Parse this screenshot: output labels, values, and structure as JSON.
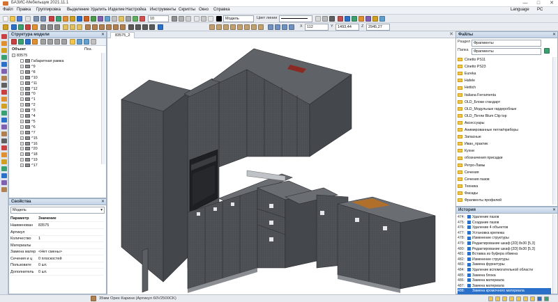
{
  "title": "БАЗИС-Мебельщик 2021.11.1",
  "window_controls": {
    "minimize": "—",
    "maximize": "□",
    "close": "✕"
  },
  "menu": [
    "Файл",
    "Правка",
    "Группировка",
    "Выделение",
    "Удалить",
    "Изделие",
    "Настройка",
    "Инструменты",
    "Скрипты",
    "Окно",
    "Справка"
  ],
  "menu_right": {
    "language": "Language",
    "pc": "PC"
  },
  "toolbar": {
    "layer_combo": "Модель",
    "line_color_label": "Цвет линии",
    "zoom_value": "10",
    "x_label": "X",
    "x_value": "112",
    "y_label": "Y",
    "y_value": "1493,44",
    "z_label": "Z",
    "z_value": "2945,27"
  },
  "model_tree": {
    "title": "Структура модели",
    "close": "✕",
    "col_object": "Объект",
    "col_pos": "Поз.",
    "root": "83575",
    "items": [
      "Габаритная рамка",
      "^9",
      "^8",
      "^10",
      "^11",
      "^12",
      "^0",
      "^1",
      "^2",
      "^3",
      "^4",
      "^5",
      "^6",
      "^7",
      "^15",
      "^16",
      "^20",
      "^18",
      "^19",
      "^17"
    ]
  },
  "properties": {
    "title": "Свойства",
    "close": "✕",
    "selector": "Модель",
    "col_param": "Параметр",
    "col_value": "Значение",
    "rows": [
      {
        "key": "Наименован",
        "value": "83575"
      },
      {
        "key": "Артикул",
        "value": ""
      },
      {
        "key": "Количество",
        "value": "1"
      },
      {
        "key": "Материалы",
        "value": ""
      },
      {
        "key": "Замена матер",
        "value": "<Нет смены>"
      },
      {
        "key": "Сечения и ц",
        "value": "0 плоскостей"
      },
      {
        "key": "Пользовате",
        "value": "0 шт."
      },
      {
        "key": "Дополнитель",
        "value": "0 шт."
      }
    ]
  },
  "viewport": {
    "tab": "83575_2"
  },
  "files": {
    "title": "Файлы",
    "close": "✕",
    "section_label": "Раздел",
    "section_value": "Фрагменты",
    "folder_label": "Папка",
    "folder_value": "Фрагменты",
    "folders": [
      "Cinetto PS11",
      "Cinetto PS23",
      "Eureka",
      "Hafele",
      "Hettich",
      "Italiana Ferramenta",
      "OLD_Блоки стандарт",
      "OLD_Модульные гардеробные",
      "OLD_Петли Blum Clip top",
      "Аксессуары",
      "Анимированные петли/приборы",
      "Запасные",
      "Иван_практик",
      "Кухни",
      "обозначения присадки",
      "Ретро-Ламы",
      "Сечения",
      "Сечения пазов",
      "Техника",
      "Фасады",
      "Фрагменты профилей"
    ]
  },
  "history": {
    "title": "История",
    "close": "✕",
    "rows": [
      {
        "n": "474:",
        "text": "Удаление пазов"
      },
      {
        "n": "475:",
        "text": "Создание пазов"
      },
      {
        "n": "476:",
        "text": "Удаление 4 объектов"
      },
      {
        "n": "477:",
        "text": "Установка крепежа"
      },
      {
        "n": "478:",
        "text": "Изменение структуры"
      },
      {
        "n": "479:",
        "text": "Редактирование шкаф [2D] 8x30 [5,3]"
      },
      {
        "n": "480:",
        "text": "Редактирование шкаф [2D] 8x30 [5,3]"
      },
      {
        "n": "481:",
        "text": "Вставка из буфера обмена"
      },
      {
        "n": "482:",
        "text": "Изменение структуры"
      },
      {
        "n": "483:",
        "text": "Замена фурнитуры"
      },
      {
        "n": "484:",
        "text": "Удаление вспомогательной области"
      },
      {
        "n": "485:",
        "text": "Замена блока"
      },
      {
        "n": "486:",
        "text": "Замена материала"
      },
      {
        "n": "487:",
        "text": "Замена материала"
      },
      {
        "n": "488:",
        "text": "Замена кромочного материала"
      }
    ]
  },
  "status": {
    "material": "35мм Орех Карини (Артикул 60V2500CK)"
  },
  "colors": {
    "accent": "#2a70c8",
    "cabinet": "#4a4d52",
    "folder": "#f2c64a"
  }
}
